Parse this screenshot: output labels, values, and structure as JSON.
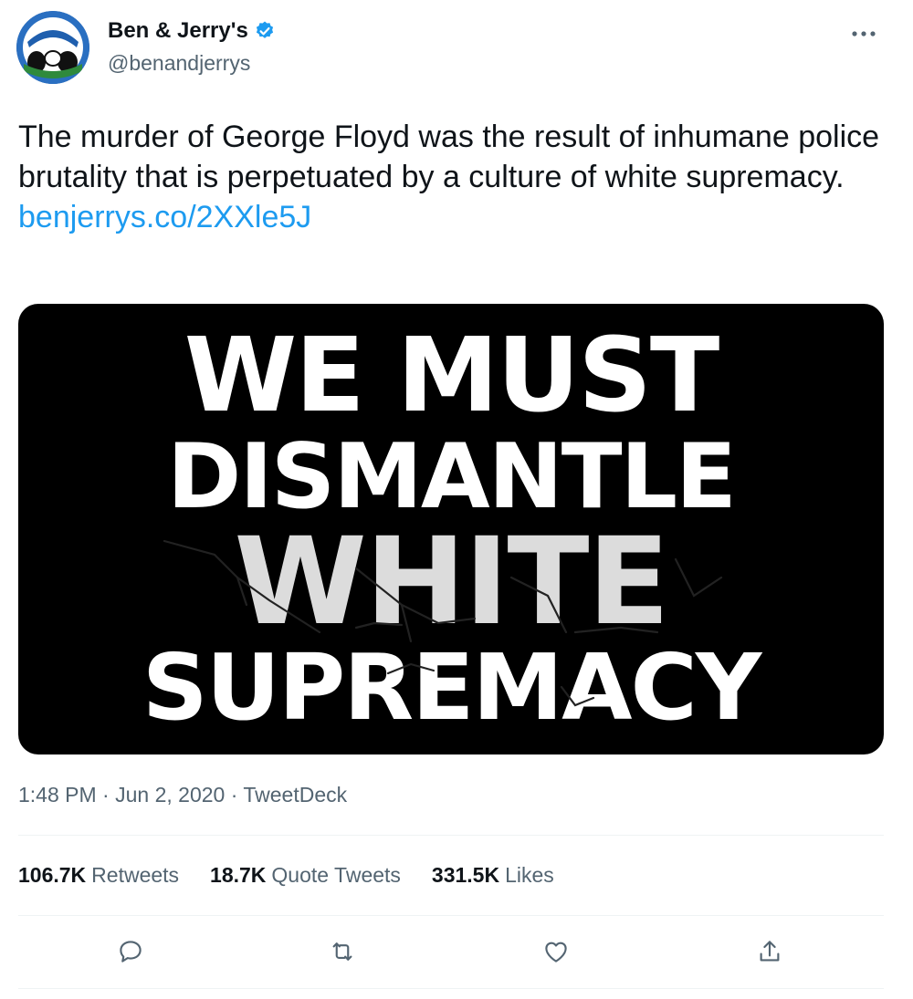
{
  "author": {
    "display_name": "Ben & Jerry's",
    "handle": "@benandjerrys",
    "verified": true,
    "avatar_icon": "ben-and-jerrys-logo-avatar"
  },
  "tweet": {
    "text": "The murder of George Floyd was the result of inhumane police brutality that is perpetuated by a culture of white supremacy.",
    "link": "benjerrys.co/2XXle5J"
  },
  "media": {
    "lines": [
      "WE MUST",
      "DISMANTLE",
      "WHITE",
      "SUPREMACY"
    ],
    "background": "#000000"
  },
  "meta": {
    "time": "1:48 PM",
    "separator_1": "·",
    "date": "Jun 2, 2020",
    "separator_2": "·",
    "source": "TweetDeck"
  },
  "stats": [
    {
      "count": "106.7K",
      "label": "Retweets"
    },
    {
      "count": "18.7K",
      "label": "Quote Tweets"
    },
    {
      "count": "331.5K",
      "label": "Likes"
    }
  ],
  "actions": [
    {
      "icon": "reply-icon"
    },
    {
      "icon": "retweet-icon"
    },
    {
      "icon": "like-heart-icon"
    },
    {
      "icon": "share-icon"
    }
  ],
  "colors": {
    "text_primary": "#0f1419",
    "text_secondary": "#536471",
    "link": "#1d9bf0",
    "verified_badge": "#1d9bf0",
    "avatar_bg": "#1f5fae"
  }
}
